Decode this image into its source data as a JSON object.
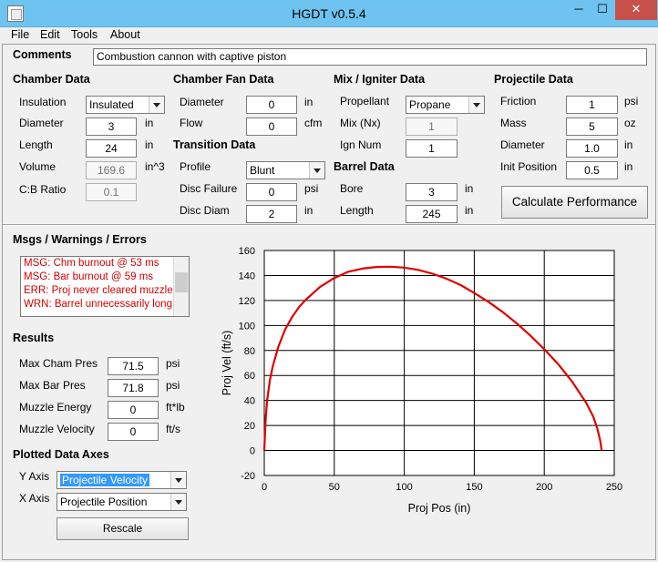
{
  "window": {
    "title": "HGDT v0.5.4",
    "minimize": "─",
    "maximize": "☐",
    "close": "✕"
  },
  "menu": [
    "File",
    "Edit",
    "Tools",
    "About"
  ],
  "comments": {
    "label": "Comments",
    "value": "Combustion cannon with captive piston"
  },
  "chamber": {
    "title": "Chamber Data",
    "insulation_label": "Insulation",
    "insulation_value": "Insulated",
    "diameter_label": "Diameter",
    "diameter_value": "3",
    "diameter_unit": "in",
    "length_label": "Length",
    "length_value": "24",
    "length_unit": "in",
    "volume_label": "Volume",
    "volume_value": "169.6",
    "volume_unit": "in^3",
    "cb_label": "C:B Ratio",
    "cb_value": "0.1"
  },
  "fan": {
    "title": "Chamber Fan Data",
    "diameter_label": "Diameter",
    "diameter_value": "0",
    "diameter_unit": "in",
    "flow_label": "Flow",
    "flow_value": "0",
    "flow_unit": "cfm"
  },
  "transition": {
    "title": "Transition Data",
    "profile_label": "Profile",
    "profile_value": "Blunt",
    "disc_failure_label": "Disc Failure",
    "disc_failure_value": "0",
    "disc_failure_unit": "psi",
    "disc_diam_label": "Disc Diam",
    "disc_diam_value": "2",
    "disc_diam_unit": "in"
  },
  "mix": {
    "title": "Mix / Igniter Data",
    "propellant_label": "Propellant",
    "propellant_value": "Propane",
    "mix_label": "Mix (Nx)",
    "mix_value": "1",
    "ign_label": "Ign Num",
    "ign_value": "1"
  },
  "barrel": {
    "title": "Barrel Data",
    "bore_label": "Bore",
    "bore_value": "3",
    "bore_unit": "in",
    "length_label": "Length",
    "length_value": "245",
    "length_unit": "in"
  },
  "projectile": {
    "title": "Projectile Data",
    "friction_label": "Friction",
    "friction_value": "1",
    "friction_unit": "psi",
    "mass_label": "Mass",
    "mass_value": "5",
    "mass_unit": "oz",
    "diameter_label": "Diameter",
    "diameter_value": "1.0",
    "diameter_unit": "in",
    "init_label": "Init Position",
    "init_value": "0.5",
    "init_unit": "in"
  },
  "calc_button": "Calculate Performance",
  "messages": {
    "title": "Msgs / Warnings / Errors",
    "lines": [
      "MSG: Chm burnout @ 53 ms",
      "MSG: Bar burnout @ 59 ms",
      "ERR: Proj never cleared muzzle",
      "WRN: Barrel unnecessarily long"
    ]
  },
  "results": {
    "title": "Results",
    "max_cham_label": "Max Cham Pres",
    "max_cham_value": "71.5",
    "max_cham_unit": "psi",
    "max_bar_label": "Max Bar Pres",
    "max_bar_value": "71.8",
    "max_bar_unit": "psi",
    "energy_label": "Muzzle Energy",
    "energy_value": "0",
    "energy_unit": "ft*lb",
    "velocity_label": "Muzzle Velocity",
    "velocity_value": "0",
    "velocity_unit": "ft/s"
  },
  "axes": {
    "title": "Plotted Data Axes",
    "y_label": "Y Axis",
    "y_value": "Projectile Velocity",
    "x_label": "X Axis",
    "x_value": "Projectile Position",
    "rescale": "Rescale"
  },
  "colors": {
    "curve": "#e00000",
    "error_text": "#d40000"
  },
  "chart_data": {
    "type": "line",
    "xlabel": "Proj Pos (in)",
    "ylabel": "Proj Vel (ft/s)",
    "xlim": [
      0,
      250
    ],
    "ylim": [
      -20,
      160
    ],
    "xticks": [
      0,
      50,
      100,
      150,
      200,
      250
    ],
    "yticks": [
      -20,
      0,
      20,
      40,
      60,
      80,
      100,
      120,
      140,
      160
    ],
    "grid": true,
    "series": [
      {
        "x": [
          0,
          1,
          2,
          4,
          6,
          10,
          15,
          20,
          25,
          30,
          40,
          50,
          60,
          70,
          80,
          90,
          100,
          110,
          120,
          130,
          140,
          150,
          160,
          170,
          180,
          190,
          200,
          210,
          220,
          230,
          235,
          238,
          240,
          241
        ],
        "y": [
          0,
          25,
          40,
          56,
          67,
          83,
          97,
          107,
          115,
          121,
          131,
          138,
          143,
          145.5,
          146.8,
          147,
          146.3,
          144.5,
          141.5,
          137.5,
          132.5,
          126,
          119,
          111,
          102,
          92,
          81,
          69,
          55,
          38,
          27,
          17,
          8,
          0
        ]
      }
    ]
  }
}
